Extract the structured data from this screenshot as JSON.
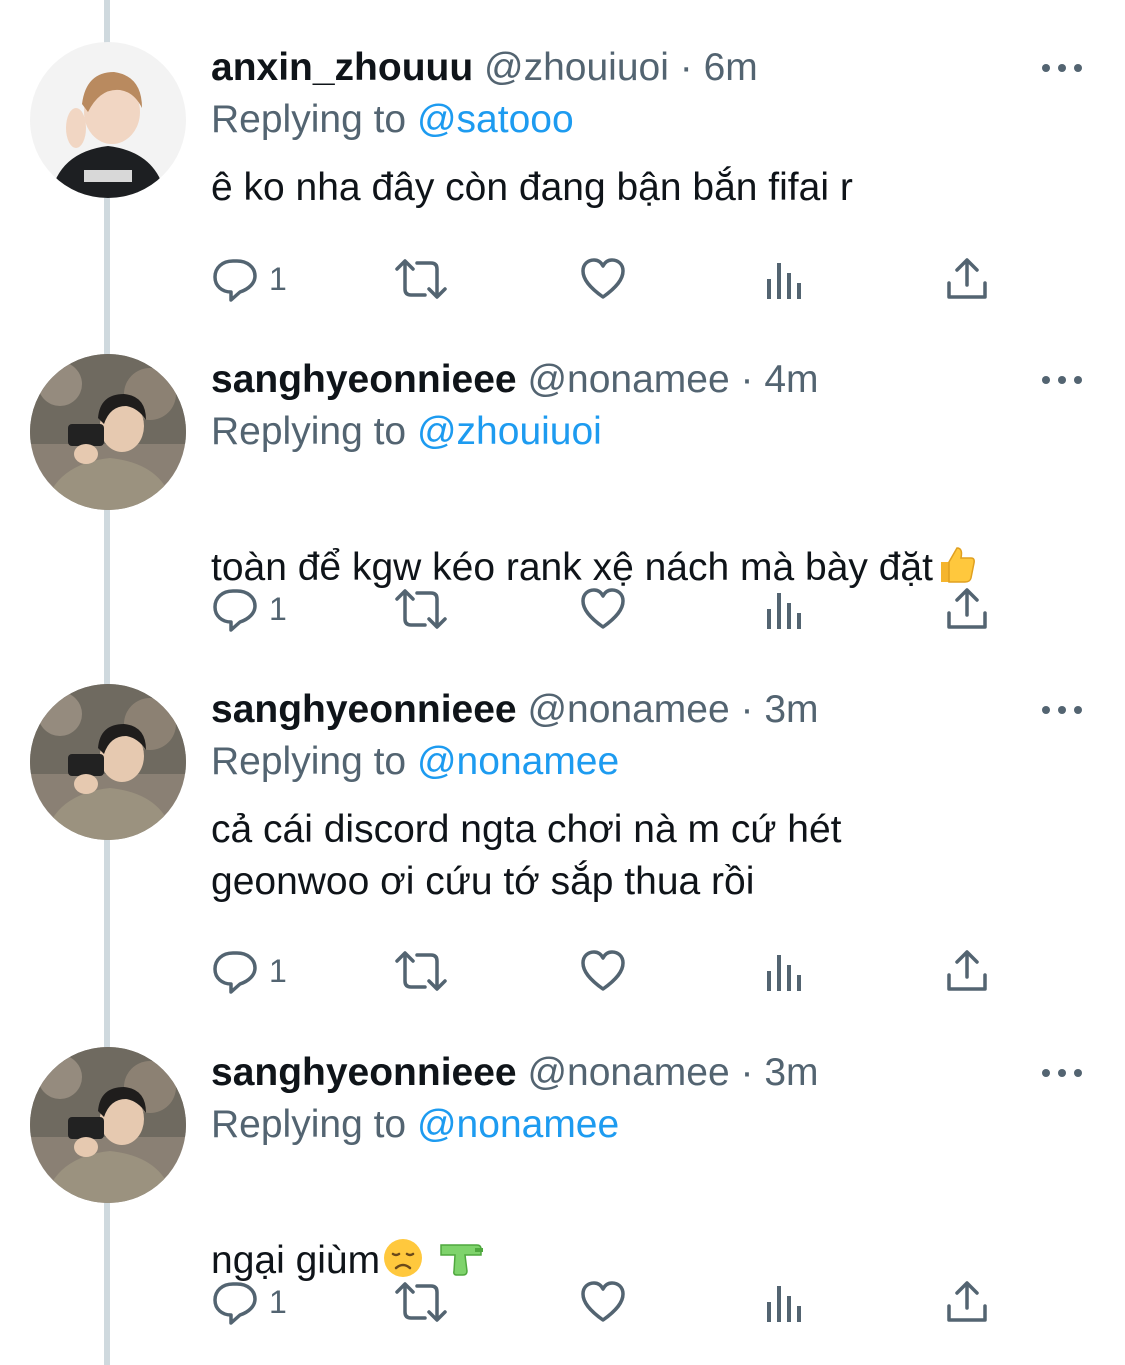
{
  "tweets": [
    {
      "name": "anxin_zhouuu",
      "handle": "@zhouiuoi",
      "dot": "·",
      "time": "6m",
      "reply_prefix": "Replying to",
      "reply_handle": "@satooo",
      "text": "ê ko nha đây còn đang bận bắn fifai r",
      "reply_count": "1"
    },
    {
      "name": "sanghyeonnieee",
      "handle": "@nonamee",
      "dot": "·",
      "time": "4m",
      "reply_prefix": "Replying to",
      "reply_handle": "@zhouiuoi",
      "text": "toàn để kgw kéo rank xệ nách mà bày đặt",
      "text_emoji": "thumbs-up-icon",
      "reply_count": "1"
    },
    {
      "name": "sanghyeonnieee",
      "handle": "@nonamee",
      "dot": "·",
      "time": "3m",
      "reply_prefix": "Replying to",
      "reply_handle": "@nonamee",
      "text": "cả cái discord ngta chơi nà m cứ hét\ngeonwoo ơi cứu tớ sắp thua rồi",
      "reply_count": "1"
    },
    {
      "name": "sanghyeonnieee",
      "handle": "@nonamee",
      "dot": "·",
      "time": "3m",
      "reply_prefix": "Replying to",
      "reply_handle": "@nonamee",
      "text": "ngại giùm",
      "text_emoji": "disappointed-face-icon, water-pistol-icon",
      "reply_count": "1"
    }
  ],
  "colors": {
    "text_primary": "#0f1419",
    "text_secondary": "#536471",
    "link": "#1d9bf0",
    "thread_line": "#cfd9de"
  },
  "icons": [
    "reply-icon",
    "retweet-icon",
    "like-icon",
    "views-icon",
    "share-icon",
    "more-icon"
  ]
}
